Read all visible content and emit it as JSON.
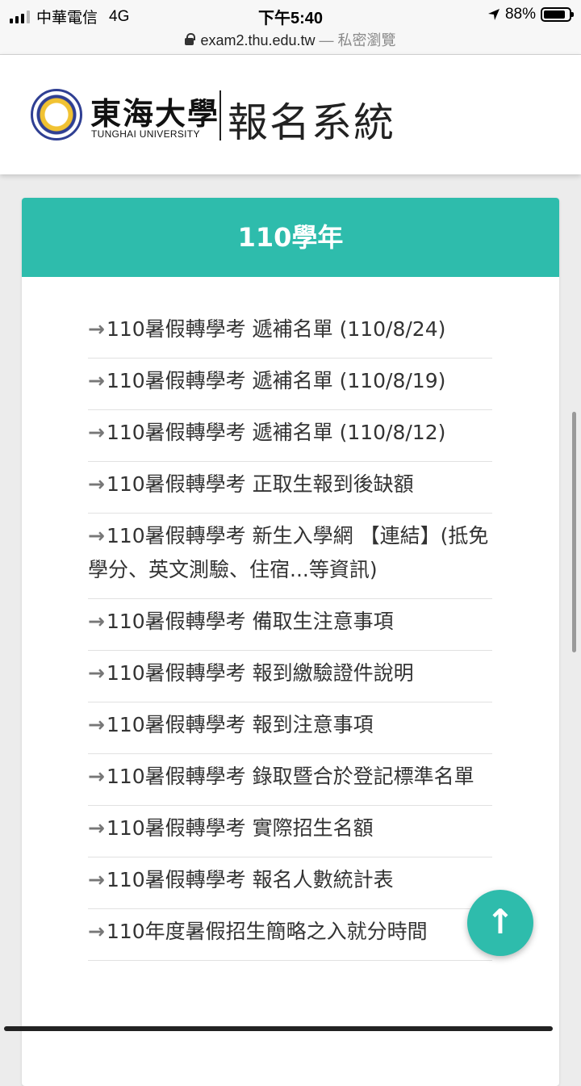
{
  "status_bar": {
    "carrier": "中華電信",
    "network": "4G",
    "time": "下午5:40",
    "battery_percent": "88%",
    "battery_level": 0.88
  },
  "browser": {
    "url": "exam2.thu.edu.tw",
    "private_label": "— 私密瀏覽"
  },
  "header": {
    "logo_zh": "東海大學",
    "logo_en": "TUNGHAI UNIVERSITY",
    "system_title": "報名系統"
  },
  "card": {
    "title": "110學年",
    "items": [
      "110暑假轉學考 遞補名單 (110/8/24)",
      "110暑假轉學考 遞補名單 (110/8/19)",
      "110暑假轉學考 遞補名單 (110/8/12)",
      "110暑假轉學考 正取生報到後缺額",
      "110暑假轉學考 新生入學網 【連結】(抵免學分、英文測驗、住宿...等資訊)",
      "110暑假轉學考 備取生注意事項",
      "110暑假轉學考 報到繳驗證件說明",
      "110暑假轉學考 報到注意事項",
      "110暑假轉學考 錄取暨合於登記標準名單",
      "110暑假轉學考 實際招生名額",
      "110暑假轉學考 報名人數統計表",
      "110年度暑假招生簡略之入就分時間"
    ]
  },
  "icons": {
    "arrow": "→",
    "to_top": "↑"
  },
  "colors": {
    "accent": "#2ebcac"
  }
}
